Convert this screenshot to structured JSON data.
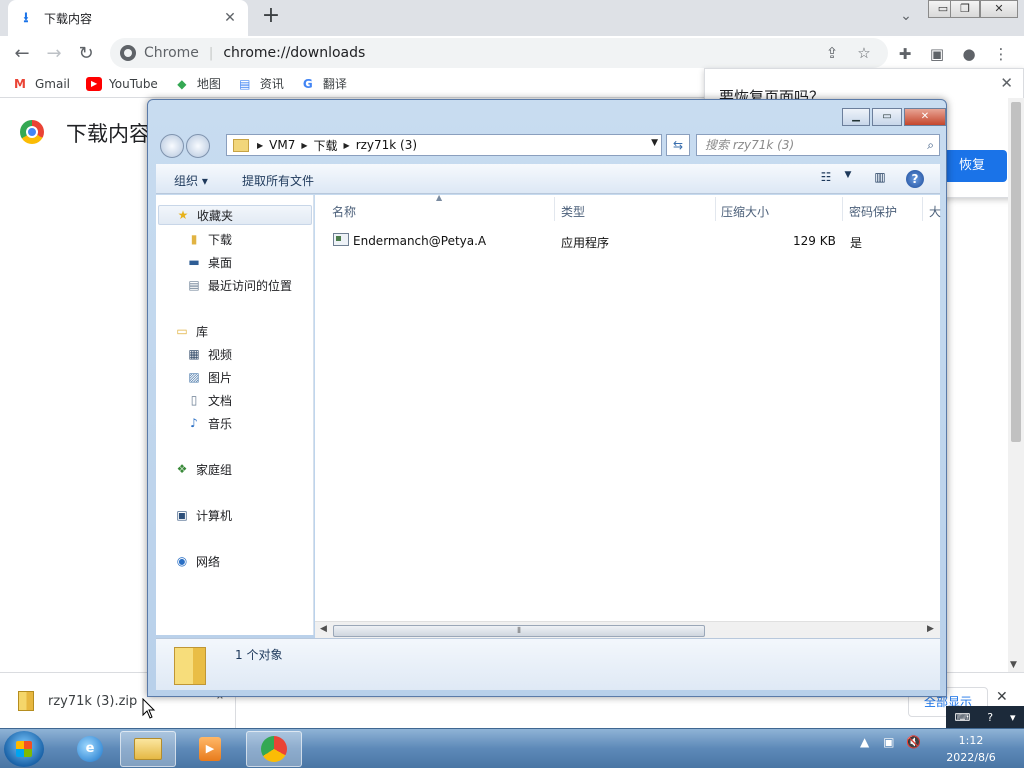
{
  "chrome": {
    "tab_title": "下载内容",
    "new_tab": "+",
    "omnibox_chip": "Chrome",
    "omnibox_sep": "|",
    "url": "chrome://downloads",
    "bookmarks": [
      {
        "label": "Gmail",
        "icon": "gmail-icon",
        "color": "#ea4335"
      },
      {
        "label": "YouTube",
        "icon": "youtube-icon",
        "color": "#ff0000"
      },
      {
        "label": "地图",
        "icon": "maps-icon",
        "color": "#34a853"
      },
      {
        "label": "资讯",
        "icon": "news-icon",
        "color": "#4285f4"
      },
      {
        "label": "翻译",
        "icon": "translate-icon",
        "color": "#4285f4"
      }
    ],
    "page_heading": "下载内容",
    "restore_question": "要恢复页面吗？",
    "restore_button": "恢复",
    "shelf": {
      "filename": "rzy71k (3).zip",
      "show_all": "全部显示"
    }
  },
  "explorer": {
    "breadcrumb": [
      "VM7",
      "下载",
      "rzy71k (3)"
    ],
    "search_placeholder": "搜索 rzy71k (3)",
    "organize": "组织 ▾",
    "extract_all": "提取所有文件",
    "nav": {
      "favorites": "收藏夹",
      "downloads": "下载",
      "desktop": "桌面",
      "recent": "最近访问的位置",
      "libraries": "库",
      "videos": "视频",
      "pictures": "图片",
      "documents": "文档",
      "music": "音乐",
      "homegroup": "家庭组",
      "computer": "计算机",
      "network": "网络"
    },
    "columns": [
      "名称",
      "类型",
      "压缩大小",
      "密码保护",
      "大"
    ],
    "files": [
      {
        "name": "Endermanch@Petya.A",
        "type": "应用程序",
        "size": "129 KB",
        "password": "是"
      }
    ],
    "status_count": "1 个对象"
  },
  "taskbar": {
    "time": "1:12",
    "date": "2022/8/6"
  }
}
